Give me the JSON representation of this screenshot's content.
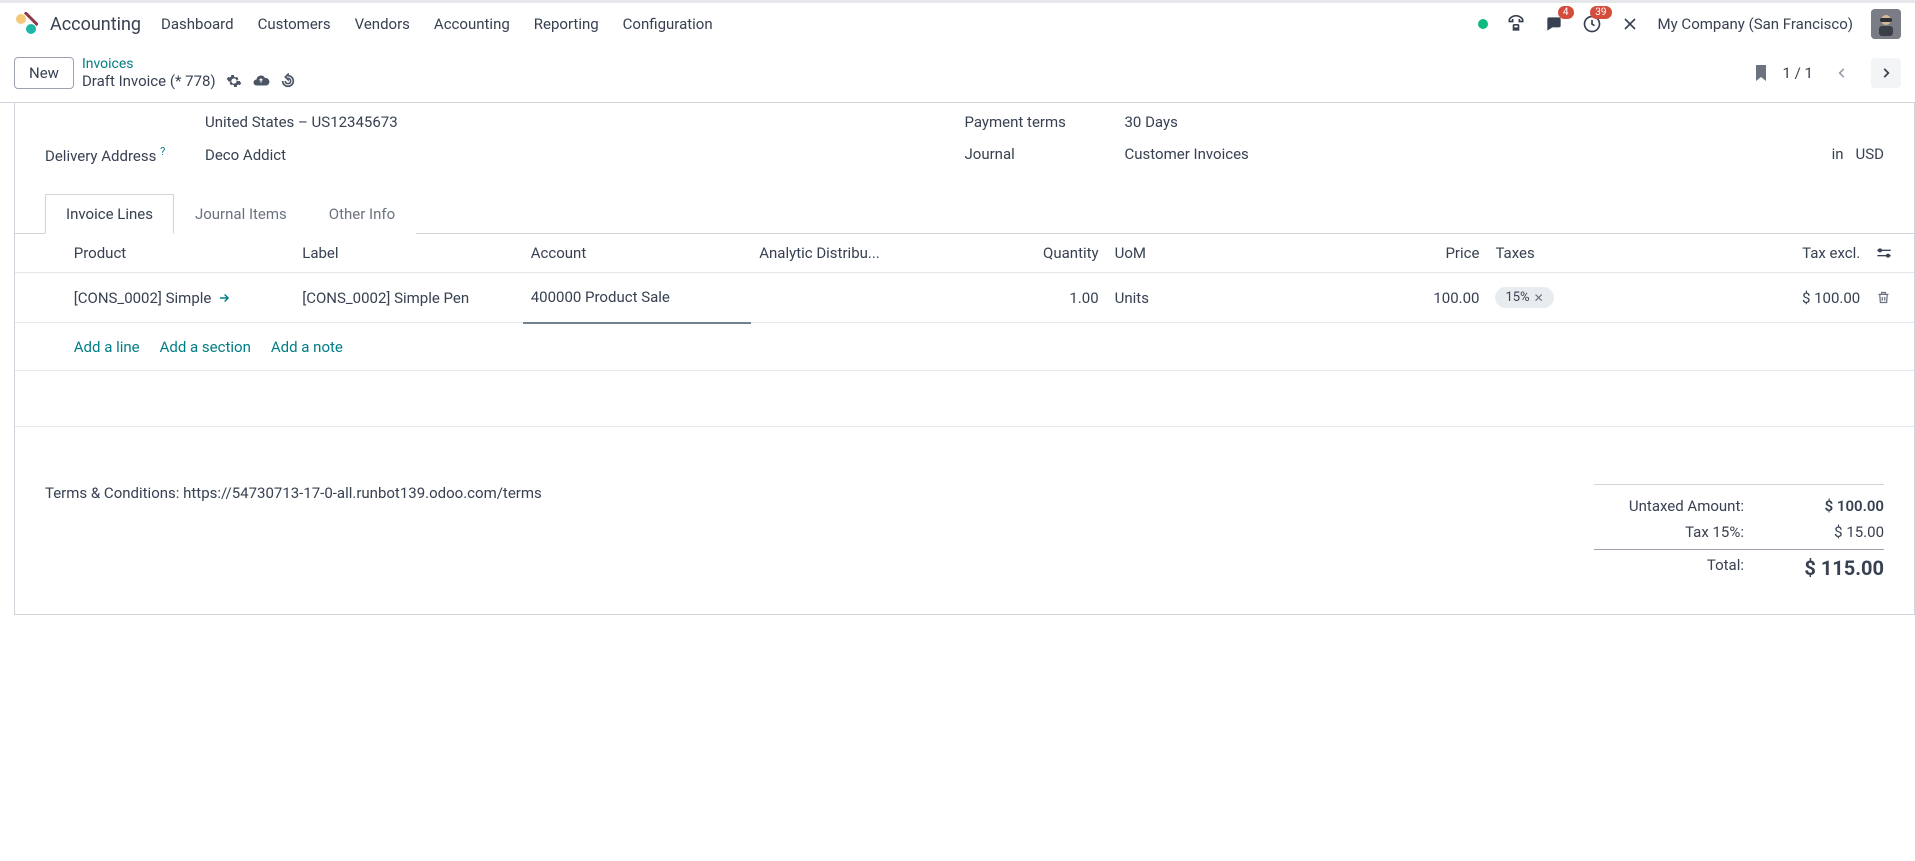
{
  "app": {
    "title": "Accounting"
  },
  "nav": {
    "items": [
      "Dashboard",
      "Customers",
      "Vendors",
      "Accounting",
      "Reporting",
      "Configuration"
    ]
  },
  "systray": {
    "messages_badge": "4",
    "activities_badge": "39",
    "company": "My Company (San Francisco)"
  },
  "actionbar": {
    "new": "New",
    "breadcrumb_link": "Invoices",
    "breadcrumb_title": "Draft Invoice (* 778)",
    "pager": "1 / 1"
  },
  "form": {
    "country_vat": "United States – US12345673",
    "delivery_label": "Delivery Address",
    "delivery_value": "Deco Addict",
    "payment_terms_label": "Payment terms",
    "payment_terms_value": "30 Days",
    "journal_label": "Journal",
    "journal_value": "Customer Invoices",
    "journal_in": "in",
    "journal_currency": "USD"
  },
  "tabs": [
    "Invoice Lines",
    "Journal Items",
    "Other Info"
  ],
  "columns": {
    "product": "Product",
    "label": "Label",
    "account": "Account",
    "analytic": "Analytic Distribu...",
    "quantity": "Quantity",
    "uom": "UoM",
    "price": "Price",
    "taxes": "Taxes",
    "tax_excl": "Tax excl."
  },
  "line": {
    "product": "[CONS_0002] Simple",
    "label": "[CONS_0002] Simple Pen",
    "account": "400000 Product Sale",
    "quantity": "1.00",
    "uom": "Units",
    "price": "100.00",
    "tax": "15%",
    "tax_excl": "$ 100.00"
  },
  "addline": {
    "line": "Add a line",
    "section": "Add a section",
    "note": "Add a note"
  },
  "footer": {
    "terms": "Terms & Conditions: https://54730713-17-0-all.runbot139.odoo.com/terms",
    "untaxed_label": "Untaxed Amount:",
    "untaxed_amount": "$ 100.00",
    "tax_label": "Tax 15%:",
    "tax_amount": "$ 15.00",
    "total_label": "Total:",
    "total_amount": "$ 115.00"
  }
}
